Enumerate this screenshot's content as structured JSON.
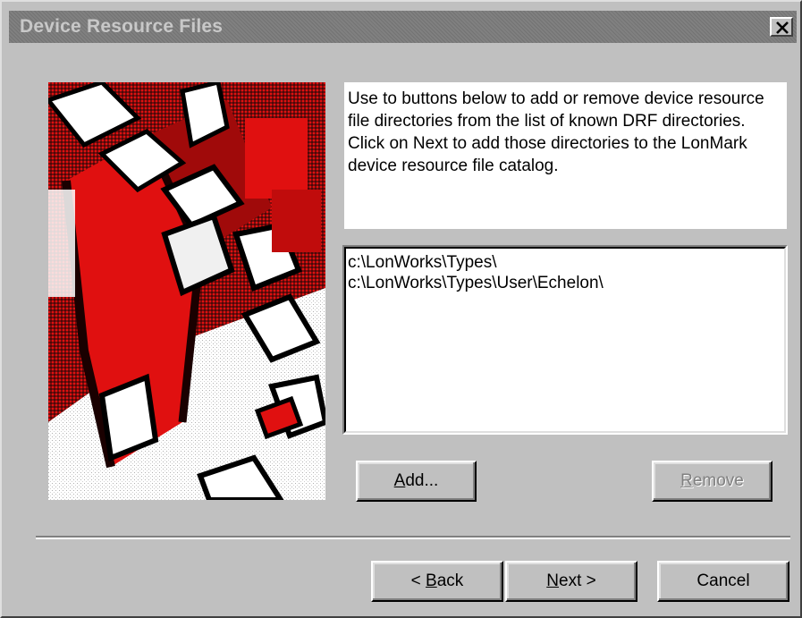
{
  "window": {
    "title": "Device Resource Files"
  },
  "description": "Use to buttons below to add or remove device resource file directories from the list of known DRF directories. Click on Next to add those directories to the LonMark device resource file catalog.",
  "directories": [
    "c:\\LonWorks\\Types\\",
    "c:\\LonWorks\\Types\\User\\Echelon\\"
  ],
  "buttons": {
    "add": {
      "mnemonic": "A",
      "rest": "dd..."
    },
    "remove": {
      "mnemonic": "R",
      "rest": "emove",
      "enabled": false
    },
    "back": {
      "prefix": "< ",
      "mnemonic": "B",
      "rest": "ack"
    },
    "next": {
      "mnemonic": "N",
      "rest": "ext >"
    },
    "cancel": {
      "label": "Cancel"
    }
  },
  "icons": {
    "close": "close-icon",
    "image": "wizard-illustration"
  },
  "colors": {
    "face": "#c0c0c0",
    "title_inactive": "#808080",
    "art_red": "#e01010"
  }
}
